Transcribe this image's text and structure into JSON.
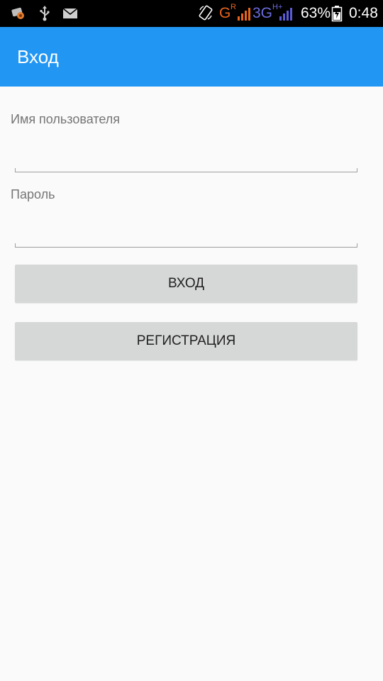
{
  "status_bar": {
    "signal_1_label": "G",
    "signal_1_sub": "R",
    "signal_2_label": "3G",
    "signal_2_sub": "H+",
    "battery": "63%",
    "time": "0:48",
    "icons": [
      "notification-icon",
      "usb-icon",
      "mail-icon",
      "rotate-icon",
      "signal-icon",
      "signal-icon",
      "battery-icon"
    ],
    "colors": {
      "signal_1": "#e8641e",
      "signal_2": "#5b5bd6"
    }
  },
  "app_bar": {
    "title": "Вход",
    "color": "#2196f3"
  },
  "form": {
    "username_label": "Имя пользователя",
    "username_value": "",
    "password_label": "Пароль",
    "password_value": "",
    "login_button": "ВХОД",
    "register_button": "РЕГИСТРАЦИЯ"
  }
}
